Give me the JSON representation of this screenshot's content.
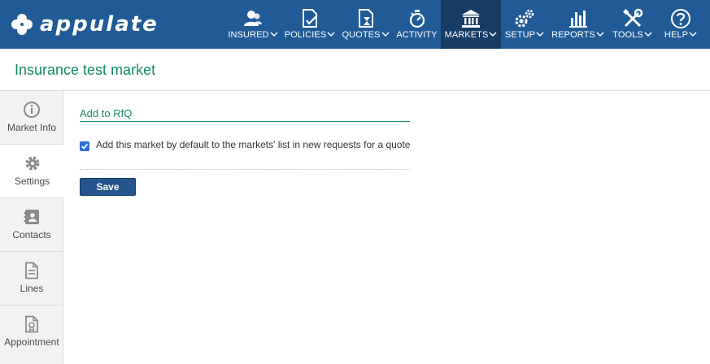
{
  "app": {
    "logo_text": "appulate"
  },
  "nav": {
    "items": [
      {
        "label": "INSURED",
        "icon": "insured-icon",
        "has_dropdown": true
      },
      {
        "label": "POLICIES",
        "icon": "policies-icon",
        "has_dropdown": true
      },
      {
        "label": "QUOTES",
        "icon": "quotes-icon",
        "has_dropdown": true
      },
      {
        "label": "ACTIVITY",
        "icon": "activity-icon",
        "has_dropdown": false
      },
      {
        "label": "MARKETS",
        "icon": "markets-icon",
        "has_dropdown": true,
        "active": true
      },
      {
        "label": "SETUP",
        "icon": "setup-icon",
        "has_dropdown": true
      },
      {
        "label": "REPORTS",
        "icon": "reports-icon",
        "has_dropdown": true
      },
      {
        "label": "TOOLS",
        "icon": "tools-icon",
        "has_dropdown": true
      },
      {
        "label": "HELP",
        "icon": "help-icon",
        "has_dropdown": true
      }
    ]
  },
  "page": {
    "title": "Insurance test market"
  },
  "sidebar": {
    "items": [
      {
        "label": "Market Info",
        "icon": "info-icon"
      },
      {
        "label": "Settings",
        "icon": "gear-icon",
        "selected": true
      },
      {
        "label": "Contacts",
        "icon": "contacts-icon"
      },
      {
        "label": "Lines",
        "icon": "document-icon"
      },
      {
        "label": "Appointment",
        "icon": "certificate-icon"
      }
    ]
  },
  "main": {
    "section_title": "Add to RfQ",
    "default_checkbox": {
      "label": "Add this market by default to the markets' list in new requests for a quote",
      "checked": true
    },
    "save_label": "Save"
  },
  "colors": {
    "nav_bg": "#215b97",
    "nav_active": "#173d66",
    "accent_green": "#128a66",
    "button_bg": "#25558c",
    "checkbox": "#2a6fd3"
  }
}
